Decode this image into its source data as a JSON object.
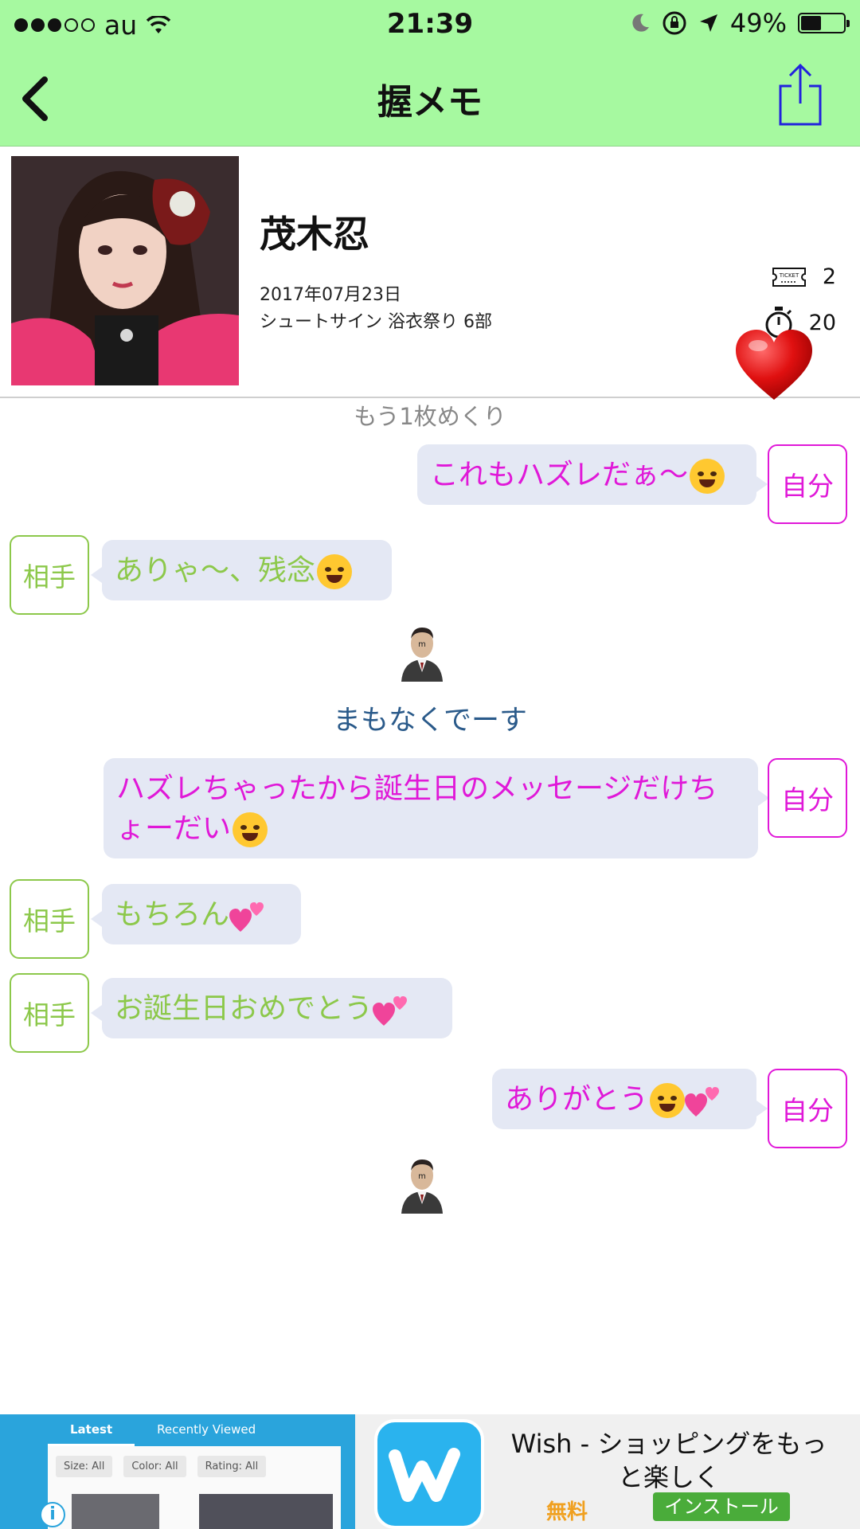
{
  "status_bar": {
    "carrier": "au",
    "time": "21:39",
    "battery": "49%",
    "battery_level": 0.49,
    "signal_bars": 3
  },
  "nav": {
    "title": "握メモ",
    "back_icon": "chevron-left-icon",
    "share_icon": "share-icon"
  },
  "profile": {
    "name": "茂木忍",
    "date": "2017年07月23日",
    "event": "シュートサイン 浴衣祭り 6部",
    "tickets": "2",
    "seconds": "20"
  },
  "reveal_label": "もう1枚めくり",
  "messages": [
    {
      "speaker": "自分",
      "text": "これもハズレだぁ〜",
      "emoji": "crying-face"
    },
    {
      "speaker": "相手",
      "text": "ありゃ〜、残念",
      "emoji": "grinning-sweat-face"
    },
    {
      "speaker": "相手",
      "text": "もちろん",
      "emoji": "two-hearts"
    },
    {
      "speaker": "相手",
      "text": "お誕生日おめでとう",
      "emoji": "two-hearts"
    },
    {
      "speaker": "自分",
      "text": "ありがとう",
      "emoji": "crying-face two-hearts"
    }
  ],
  "long_message": {
    "speaker": "自分",
    "line1": "ハズレちゃったから誕生日のメッセージだけち",
    "line2": "ょーだい",
    "emoji": "crying-face"
  },
  "announce": "まもなくでーす",
  "ad": {
    "tab_latest": "Latest",
    "tab_recent": "Recently Viewed",
    "filter_size": "Size: All",
    "filter_color": "Color: All",
    "filter_rating": "Rating: All",
    "title": "Wish - ショッピングをもっと楽しく",
    "price": "無料",
    "install": "インストール"
  },
  "colors": {
    "bar_green": "#a6f9a0",
    "self_magenta": "#e018d8",
    "other_green": "#8cc84a",
    "bubble_bg": "#e4e8f4"
  }
}
